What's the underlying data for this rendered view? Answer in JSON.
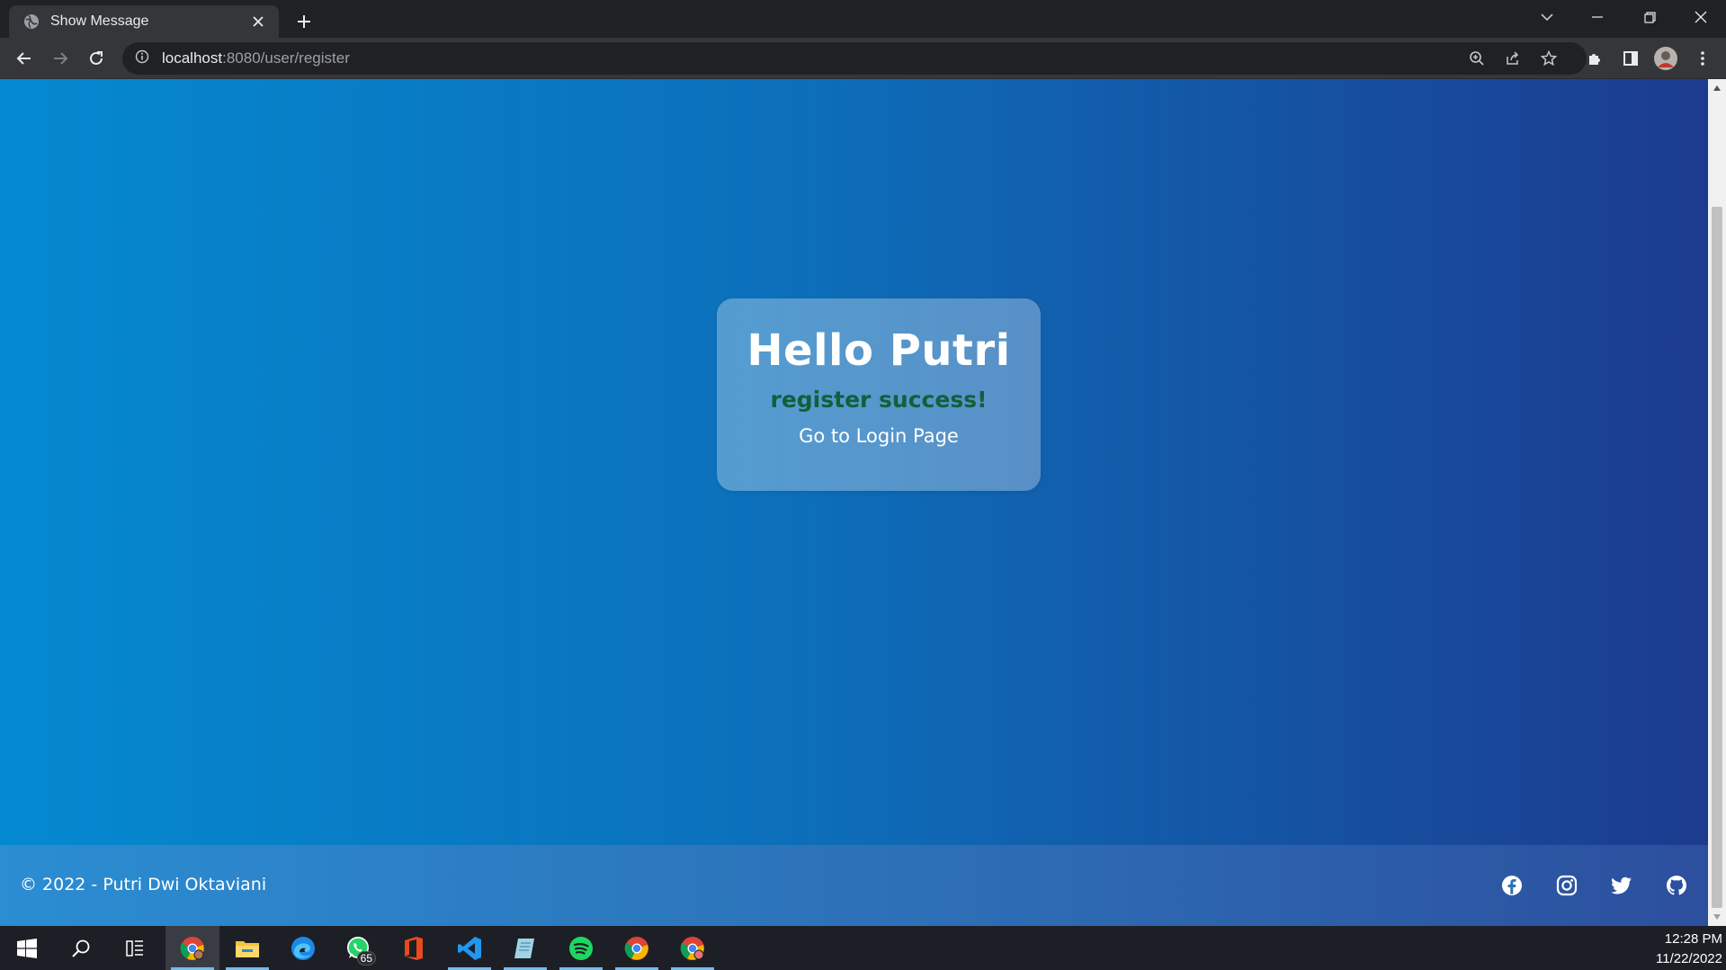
{
  "browser": {
    "tab_title": "Show Message",
    "url_host": "localhost",
    "url_rest": ":8080/user/register"
  },
  "page": {
    "greeting": "Hello Putri",
    "message": "register success!",
    "login_link": "Go to Login Page",
    "footer_text": "© 2022 - Putri Dwi Oktaviani",
    "social_icons": [
      "facebook-icon",
      "instagram-icon",
      "twitter-icon",
      "github-icon"
    ],
    "colors": {
      "gradient_start": "#0489d0",
      "gradient_end": "#1c3b8f",
      "message_color": "#11603c"
    }
  },
  "taskbar": {
    "apps": [
      "start",
      "search",
      "task-view",
      "chrome-profile",
      "file-explorer",
      "edge",
      "whatsapp",
      "office",
      "vscode",
      "notepad",
      "spotify",
      "chrome",
      "chrome-profile-2"
    ],
    "whatsapp_badge": "65",
    "time": "12:28 PM",
    "date": "11/22/2022"
  }
}
